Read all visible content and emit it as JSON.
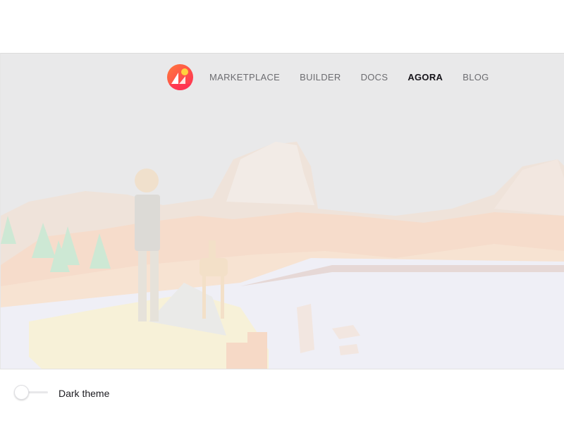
{
  "nav": {
    "logo_icon": "decentraland-logo-icon",
    "items": [
      {
        "label": "MARKETPLACE",
        "active": false
      },
      {
        "label": "BUILDER",
        "active": false
      },
      {
        "label": "DOCS",
        "active": false
      },
      {
        "label": "AGORA",
        "active": true
      },
      {
        "label": "BLOG",
        "active": false
      }
    ]
  },
  "hero": {
    "image": "low-poly-landscape-illustration"
  },
  "footer": {
    "theme_toggle": {
      "label": "Dark theme",
      "checked": false
    }
  },
  "colors": {
    "logo_gradient_start": "#ff7a3c",
    "logo_gradient_end": "#ff2d55",
    "nav_text": "#6c6c70",
    "nav_active": "#16141a"
  }
}
